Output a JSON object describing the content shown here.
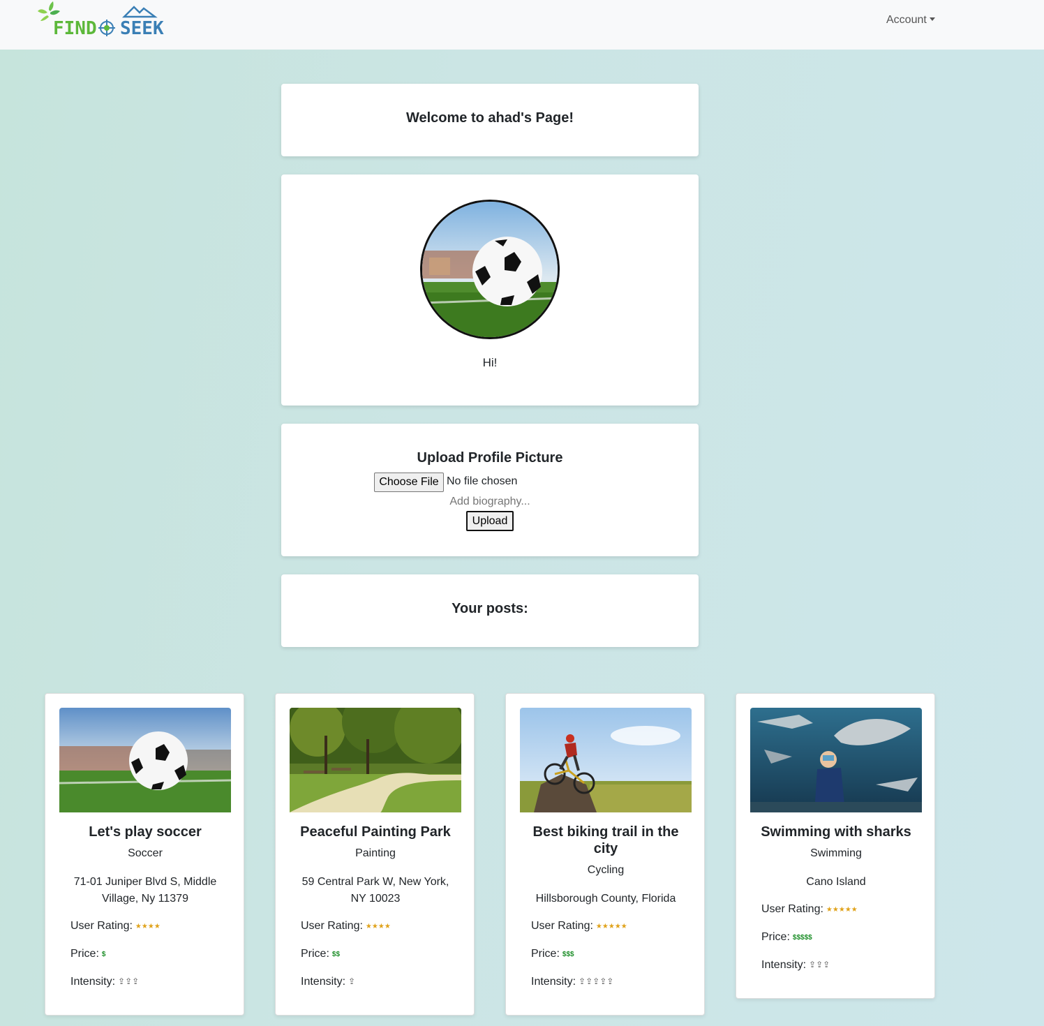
{
  "nav": {
    "logo_find": "FIND",
    "logo_seek": "SEEK",
    "account_label": "Account"
  },
  "welcome": {
    "title": "Welcome to ahad's Page!"
  },
  "profile": {
    "bio": "Hi!"
  },
  "upload": {
    "title": "Upload Profile Picture",
    "choose_file_label": "Choose File",
    "no_file_text": "No file chosen",
    "bio_placeholder": "Add biography...",
    "upload_label": "Upload"
  },
  "posts": {
    "title": "Your posts:",
    "items": [
      {
        "title": "Let's play soccer",
        "category": "Soccer",
        "location": "71-01 Juniper Blvd S, Middle Village, Ny 11379",
        "rating_label": "User Rating:",
        "rating_symbols": "★★★★",
        "price_label": "Price:",
        "price_symbols": "$",
        "intensity_label": "Intensity:",
        "intensity_symbols": "⇪⇪⇪",
        "image": "soccer-ball"
      },
      {
        "title": "Peaceful Painting Park",
        "category": "Painting",
        "location": "59 Central Park W, New York, NY 10023",
        "rating_label": "User Rating:",
        "rating_symbols": "★★★★",
        "price_label": "Price:",
        "price_symbols": "$$",
        "intensity_label": "Intensity:",
        "intensity_symbols": "⇪",
        "image": "park-path"
      },
      {
        "title": "Best biking trail in the city",
        "category": "Cycling",
        "location": "Hillsborough County, Florida",
        "rating_label": "User Rating:",
        "rating_symbols": "★★★★★",
        "price_label": "Price:",
        "price_symbols": "$$$",
        "intensity_label": "Intensity:",
        "intensity_symbols": "⇪⇪⇪⇪⇪",
        "image": "mountain-biker"
      },
      {
        "title": "Swimming with sharks",
        "category": "Swimming",
        "location": "Cano Island",
        "rating_label": "User Rating:",
        "rating_symbols": "★★★★★",
        "price_label": "Price:",
        "price_symbols": "$$$$$",
        "intensity_label": "Intensity:",
        "intensity_symbols": "⇪⇪⇪",
        "image": "shark-diver"
      }
    ]
  },
  "colors": {
    "navbar_bg": "#f8f9fa",
    "logo_green": "#5cb83a",
    "logo_blue": "#3a7fb5",
    "star": "#e0a21a",
    "dollar": "#1e8f2a"
  }
}
